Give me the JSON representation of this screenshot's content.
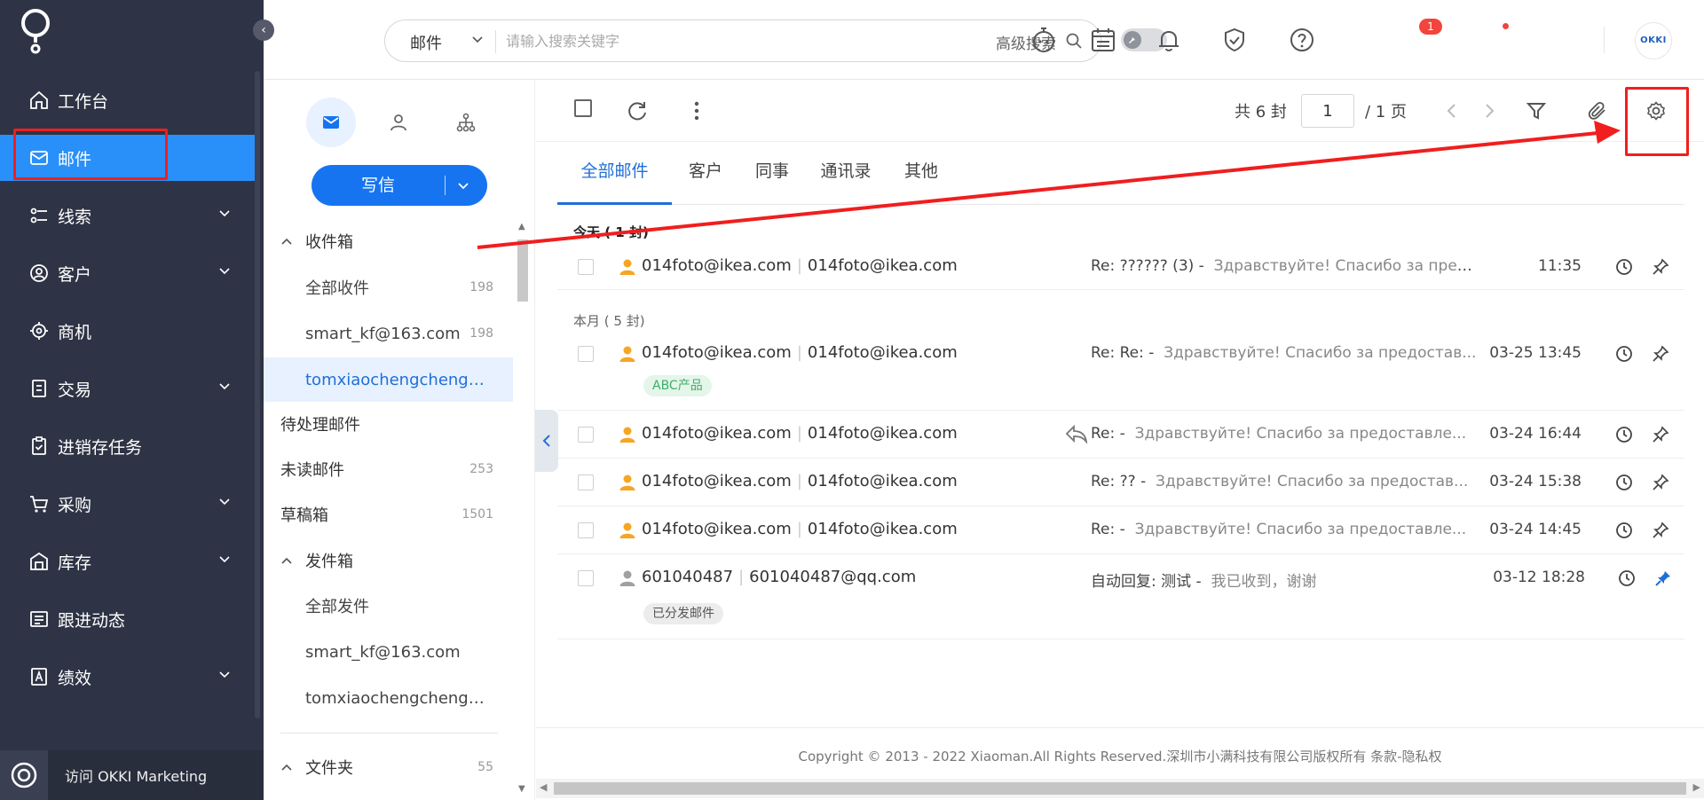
{
  "nav": {
    "items": [
      {
        "label": "工作台",
        "icon": "home-icon"
      },
      {
        "label": "邮件",
        "icon": "mail-icon"
      },
      {
        "label": "线索",
        "icon": "leads-icon"
      },
      {
        "label": "客户",
        "icon": "customer-icon"
      },
      {
        "label": "商机",
        "icon": "opportunity-icon"
      },
      {
        "label": "交易",
        "icon": "deal-icon"
      },
      {
        "label": "进销存任务",
        "icon": "inventory-task-icon"
      },
      {
        "label": "采购",
        "icon": "cart-icon"
      },
      {
        "label": "库存",
        "icon": "warehouse-icon"
      },
      {
        "label": "跟进动态",
        "icon": "activity-icon"
      },
      {
        "label": "绩效",
        "icon": "performance-icon"
      }
    ],
    "bottom_label": "访问 OKKI Marketing",
    "accent": "#2a90f9"
  },
  "topbar": {
    "search_scope": "邮件",
    "search_placeholder": "请输入搜索关键字",
    "advanced_search": "高级搜索",
    "notification_count": "1",
    "avatar_text": "OKKI"
  },
  "compose": {
    "label": "写信"
  },
  "folders": {
    "inbox": "收件箱",
    "all_inbox": {
      "label": "全部收件",
      "count": "198"
    },
    "acct1_in": {
      "label": "smart_kf@163.com",
      "count": "198"
    },
    "acct2_in": {
      "label": "tomxiaochengcheng@a..."
    },
    "pending": {
      "label": "待处理邮件"
    },
    "unread": {
      "label": "未读邮件",
      "count": "253"
    },
    "drafts": {
      "label": "草稿箱",
      "count": "1501"
    },
    "outbox": "发件箱",
    "all_sent": {
      "label": "全部发件"
    },
    "acct1_out": {
      "label": "smart_kf@163.com"
    },
    "acct2_out": {
      "label": "tomxiaochengcheng@a..."
    },
    "folder": {
      "label": "文件夹",
      "count": "55"
    }
  },
  "toolbar": {
    "total": "共 6 封",
    "page": "1",
    "of_pages": "/ 1 页"
  },
  "tabs": [
    "全部邮件",
    "客户",
    "同事",
    "通讯录",
    "其他"
  ],
  "sections": {
    "today": "今天 ( 1 封)",
    "month": "本月 ( 5 封)"
  },
  "mails": [
    {
      "from_name": "014foto@ikea.com",
      "from_addr": "014foto@ikea.com",
      "subject": "Re: ?????? (3)",
      "preview": "Здравствуйте! Спасибо за предостав...",
      "time": "11:35"
    },
    {
      "from_name": "014foto@ikea.com",
      "from_addr": "014foto@ikea.com",
      "subject": "Re: Re:",
      "preview": "Здравствуйте! Спасибо за предостав...",
      "time": "03-25 13:45",
      "tag": "ABC产品"
    },
    {
      "from_name": "014foto@ikea.com",
      "from_addr": "014foto@ikea.com",
      "subject": "Re:",
      "preview": "Здравствуйте! Спасибо за предоставле...",
      "time": "03-24 16:44"
    },
    {
      "from_name": "014foto@ikea.com",
      "from_addr": "014foto@ikea.com",
      "subject": "Re: ??",
      "preview": "Здравствуйте! Спасибо за предостав...",
      "time": "03-24 15:38"
    },
    {
      "from_name": "014foto@ikea.com",
      "from_addr": "014foto@ikea.com",
      "subject": "Re:",
      "preview": "Здравствуйте! Спасибо за предоставле...",
      "time": "03-24 14:45"
    },
    {
      "from_name": "601040487",
      "from_addr": "601040487@qq.com",
      "subject": "自动回复: 测试",
      "preview": "我已收到，谢谢",
      "time": "03-12 18:28",
      "tag": "已分发邮件"
    }
  ],
  "footer": "Copyright © 2013 - 2022 Xiaoman.All Rights Reserved.深圳市小满科技有限公司版权所有 条款-隐私权",
  "colors": {
    "annotation": "#f01e1e",
    "sender_orange": "#f5a623",
    "sender_gray": "#a0a0a0",
    "pin_blue": "#1f6fd6"
  }
}
